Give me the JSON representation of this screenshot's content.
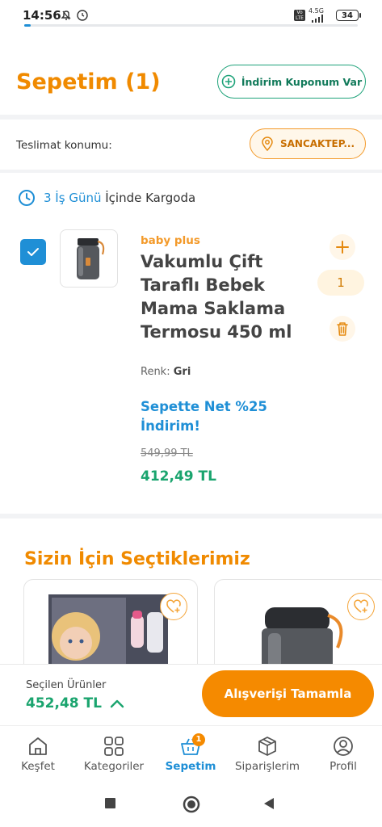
{
  "status_bar": {
    "time": "14:56",
    "network": "4.5G",
    "battery": "34"
  },
  "loading_progress": 0.02,
  "header": {
    "title": "Sepetim (1)",
    "coupon_button": "İndirim Kuponum Var"
  },
  "delivery": {
    "label": "Teslimat konumu:",
    "location": "SANCAKTEP..."
  },
  "cart": {
    "shipping_days": "3 İş Günü",
    "shipping_suffix": "İçinde Kargoda",
    "item": {
      "brand": "baby plus",
      "name": "Vakumlu Çift Taraflı Bebek Mama Saklama Termosu 450 ml",
      "color_label": "Renk:",
      "color_value": "Gri",
      "promo": "Sepette Net %25 İndirim!",
      "old_price": "549,99 TL",
      "new_price": "412,49 TL",
      "quantity": "1",
      "selected": true
    }
  },
  "recommendations": {
    "title": "Sizin İçin Seçtiklerimiz"
  },
  "checkout": {
    "selected_label": "Seçilen Ürünler",
    "total": "452,48 TL",
    "complete_button": "Alışverişi Tamamla"
  },
  "bottom_nav": {
    "items": [
      {
        "label": "Keşfet",
        "icon": "home-icon"
      },
      {
        "label": "Kategoriler",
        "icon": "grid-icon"
      },
      {
        "label": "Sepetim",
        "icon": "basket-icon",
        "badge": "1",
        "active": true
      },
      {
        "label": "Siparişlerim",
        "icon": "package-icon"
      },
      {
        "label": "Profil",
        "icon": "profile-icon"
      }
    ]
  },
  "colors": {
    "brand_orange": "#f08a00",
    "accent_blue": "#1f8fd6",
    "price_green": "#1aa46e",
    "coupon_green": "#1fa37a"
  }
}
